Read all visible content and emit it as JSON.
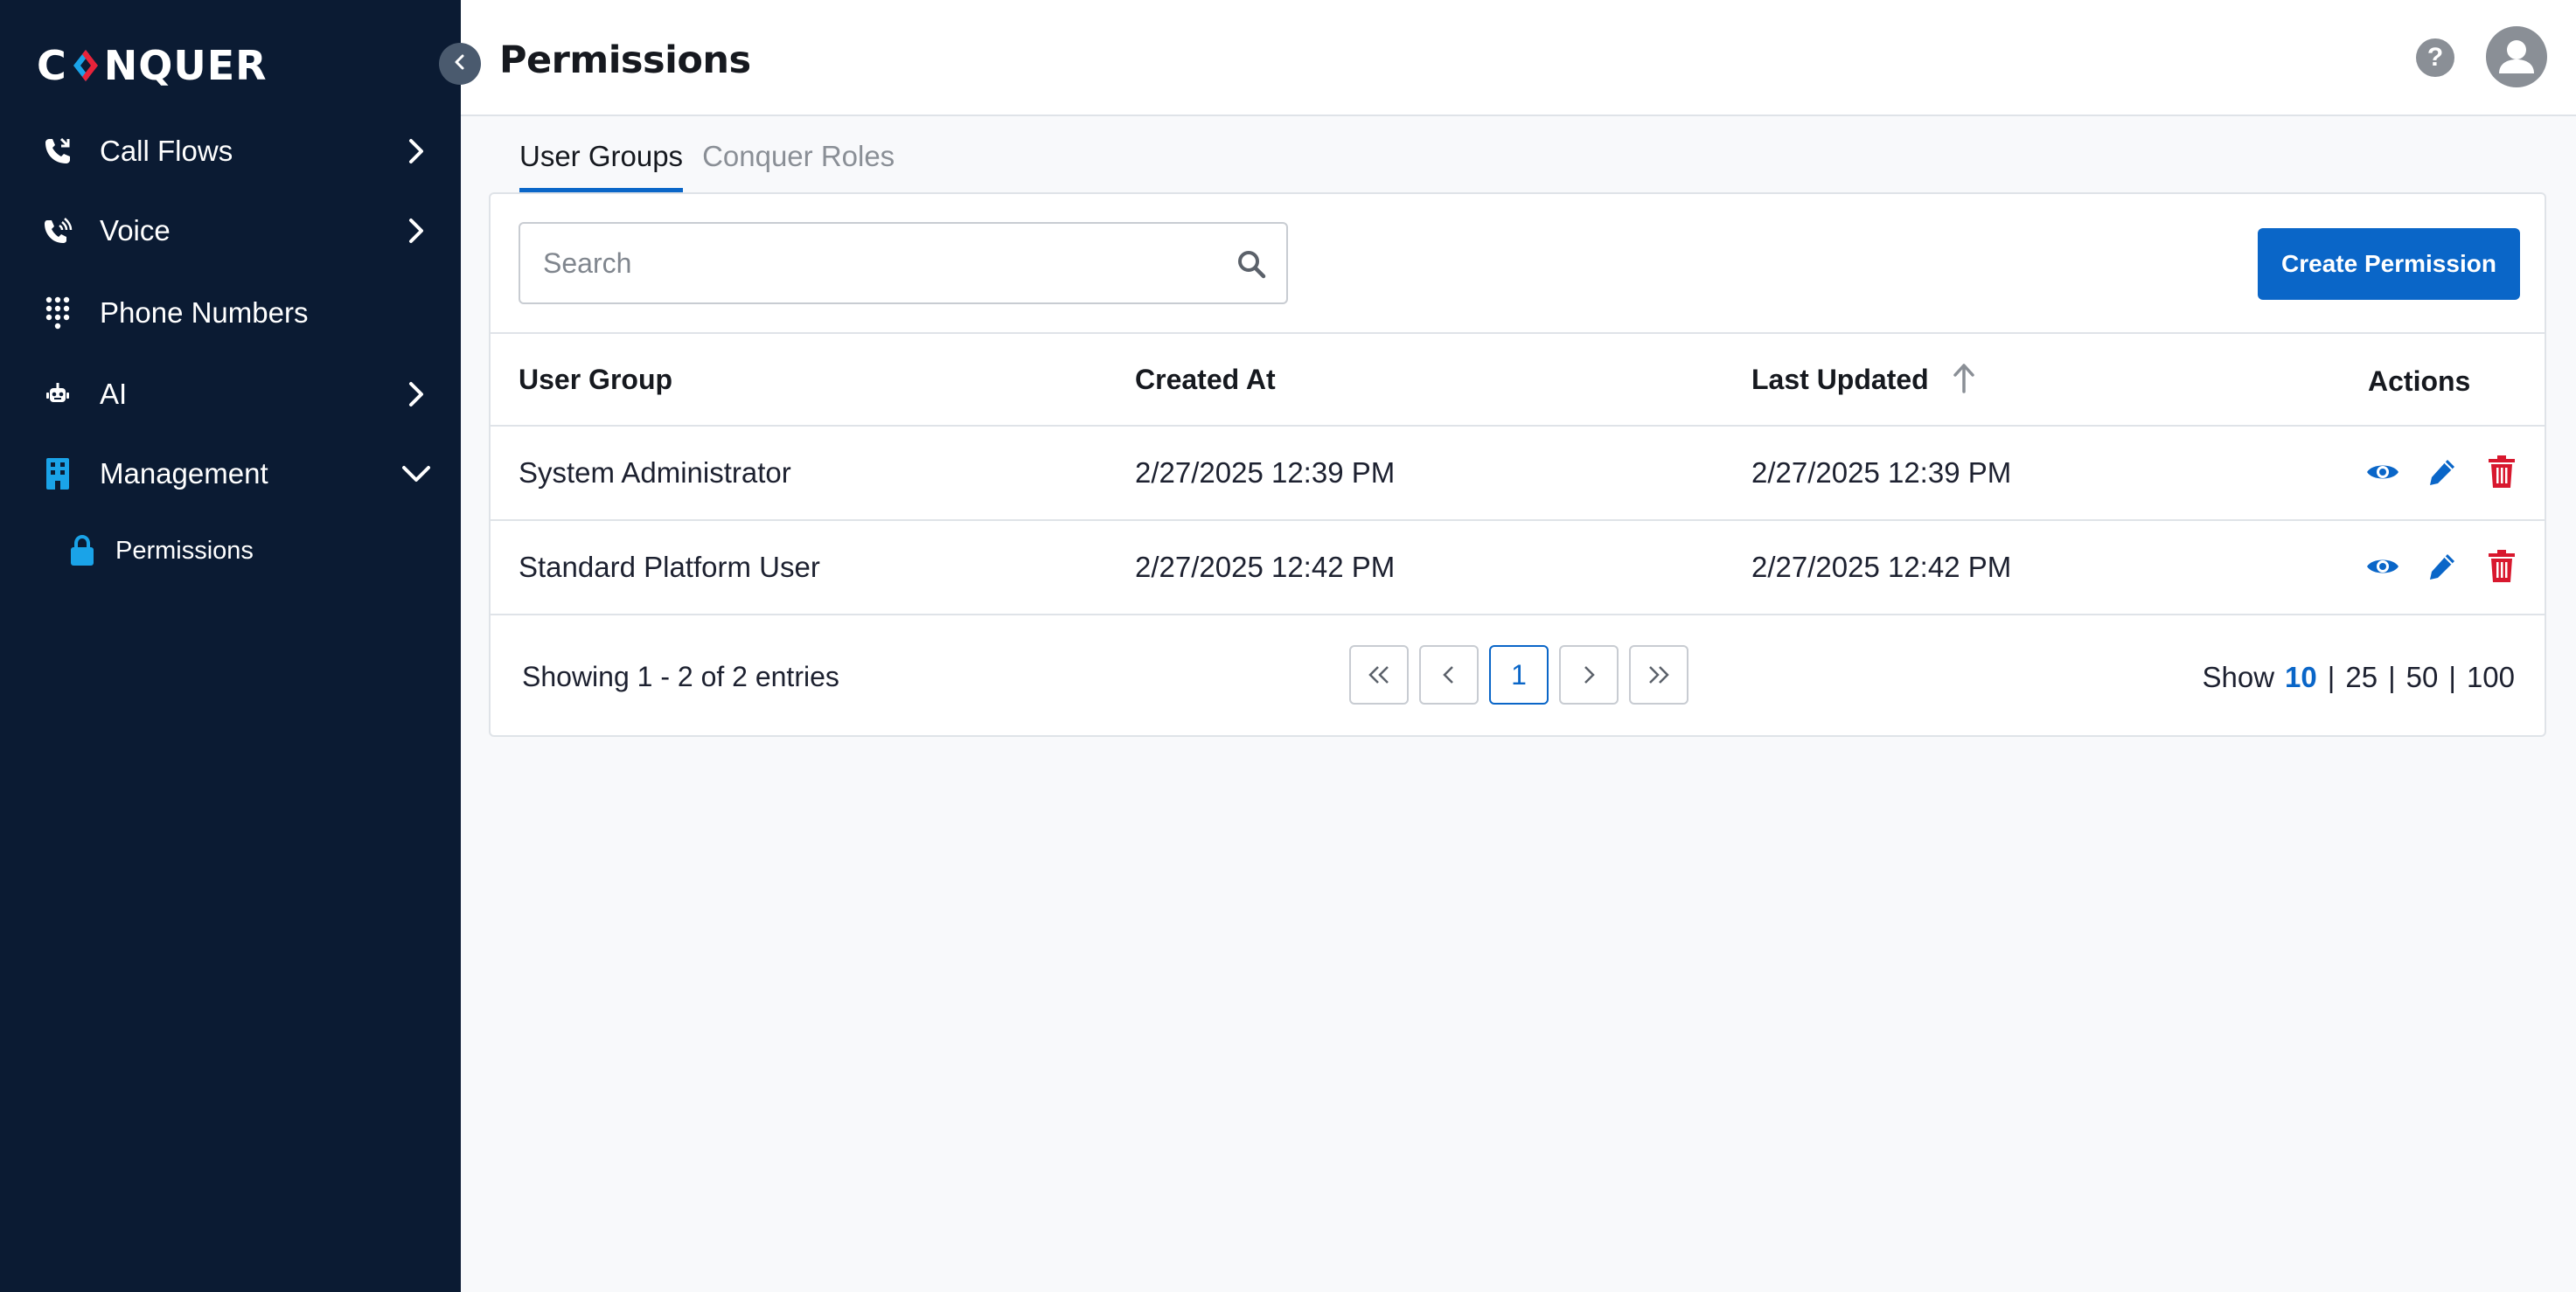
{
  "app": {
    "logo_text_left": "C",
    "logo_text_right": "NQUER"
  },
  "sidebar": {
    "items": [
      {
        "label": "Call Flows",
        "icon": "phone-call-icon",
        "chevron": "right"
      },
      {
        "label": "Voice",
        "icon": "phone-voice-icon",
        "chevron": "right"
      },
      {
        "label": "Phone Numbers",
        "icon": "dialpad-icon",
        "chevron": null
      },
      {
        "label": "AI",
        "icon": "robot-icon",
        "chevron": "right"
      },
      {
        "label": "Management",
        "icon": "building-icon",
        "chevron": "down"
      }
    ],
    "sub_items": [
      {
        "label": "Permissions",
        "icon": "lock-icon"
      }
    ]
  },
  "header": {
    "title": "Permissions",
    "help_glyph": "?"
  },
  "tabs": [
    {
      "label": "User Groups",
      "active": true
    },
    {
      "label": "Conquer Roles",
      "active": false
    }
  ],
  "toolbar": {
    "search_placeholder": "Search",
    "create_label": "Create Permission"
  },
  "table": {
    "columns": [
      "User Group",
      "Created At",
      "Last Updated",
      "Actions"
    ],
    "sort_column": "Last Updated",
    "sort_direction": "ascending",
    "rows": [
      {
        "group": "System Administrator",
        "created": "2/27/2025 12:39 PM",
        "updated": "2/27/2025 12:39 PM"
      },
      {
        "group": "Standard Platform User",
        "created": "2/27/2025 12:42 PM",
        "updated": "2/27/2025 12:42 PM"
      }
    ]
  },
  "pagination": {
    "summary": "Showing 1 - 2 of 2 entries",
    "current_page": "1",
    "show_label": "Show",
    "sizes": [
      "10",
      "25",
      "50",
      "100"
    ],
    "active_size": "10"
  },
  "colors": {
    "sidebar_bg": "#0b1b33",
    "accent": "#0a66c8",
    "danger": "#d8182e",
    "icon_blue": "#1aa3e8"
  }
}
